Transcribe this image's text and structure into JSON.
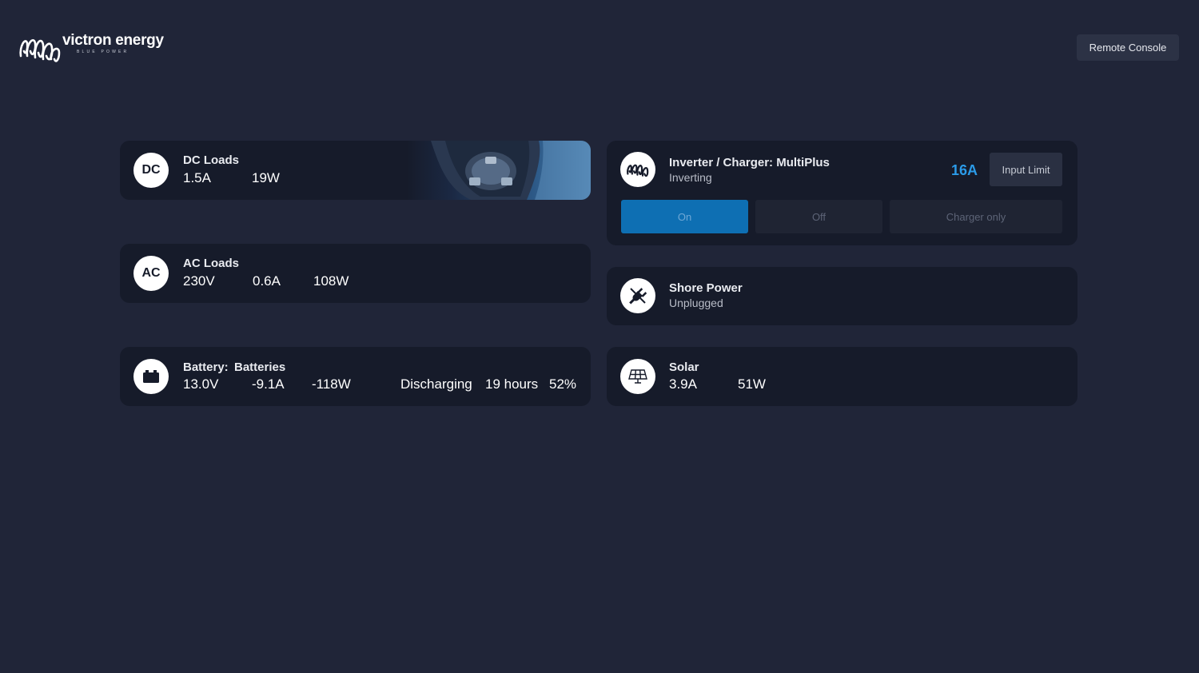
{
  "brand": {
    "name": "victron energy",
    "tagline": "BLUE POWER"
  },
  "header": {
    "remote_console_label": "Remote Console"
  },
  "dc_loads": {
    "icon_text": "DC",
    "title": "DC Loads",
    "current": "1.5A",
    "power": "19W"
  },
  "ac_loads": {
    "icon_text": "AC",
    "title": "AC Loads",
    "voltage": "230V",
    "current": "0.6A",
    "power": "108W"
  },
  "battery": {
    "title_prefix": "Battery:",
    "title_name": "Batteries",
    "voltage": "13.0V",
    "current": "-9.1A",
    "power": "-118W",
    "state": "Discharging",
    "time_remaining": "19 hours",
    "soc": "52%"
  },
  "inverter": {
    "title": "Inverter / Charger: MultiPlus",
    "status": "Inverting",
    "input_limit_value": "16A",
    "input_limit_label": "Input Limit",
    "modes": [
      {
        "label": "On",
        "active": true
      },
      {
        "label": "Off",
        "active": false
      },
      {
        "label": "Charger only",
        "active": false
      }
    ]
  },
  "shore_power": {
    "title": "Shore Power",
    "status": "Unplugged"
  },
  "solar": {
    "title": "Solar",
    "current": "3.9A",
    "power": "51W"
  },
  "colors": {
    "background": "#202538",
    "card": "#161b2a",
    "accent_blue": "#0e6fb3",
    "limit_blue": "#2b9be8"
  }
}
